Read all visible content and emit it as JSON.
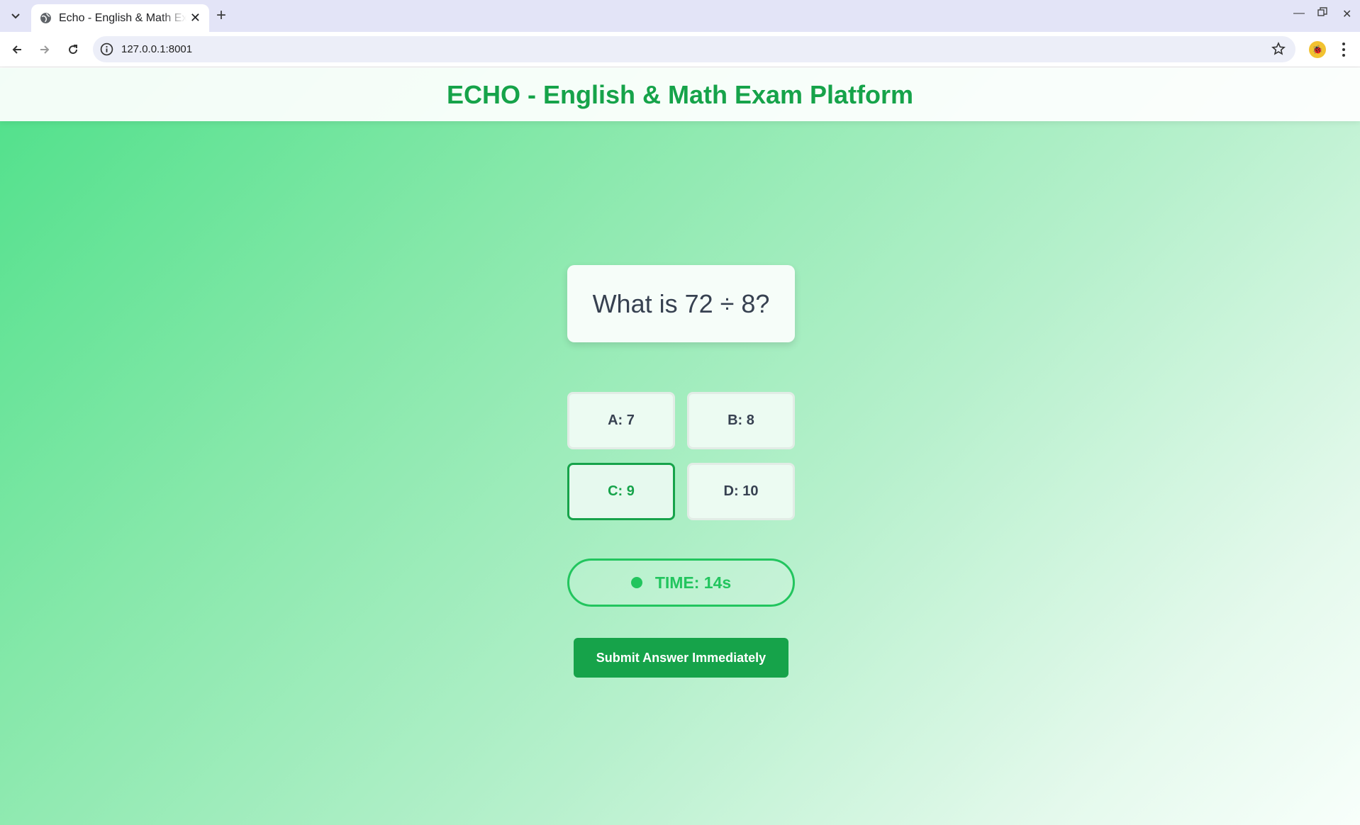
{
  "browser": {
    "tab_title": "Echo - English & Math Exam Platform",
    "url": "127.0.0.1:8001"
  },
  "header": {
    "title": "ECHO - English & Math Exam Platform"
  },
  "question": {
    "text": "What is 72 ÷ 8?"
  },
  "options": [
    {
      "label": "A: 7",
      "selected": false
    },
    {
      "label": "B: 8",
      "selected": false
    },
    {
      "label": "C: 9",
      "selected": true
    },
    {
      "label": "D: 10",
      "selected": false
    }
  ],
  "timer": {
    "label": "TIME: 14s"
  },
  "submit": {
    "label": "Submit Answer Immediately"
  },
  "colors": {
    "brand_green": "#16a34a",
    "timer_green": "#22c55e",
    "text_dark": "#374151"
  }
}
